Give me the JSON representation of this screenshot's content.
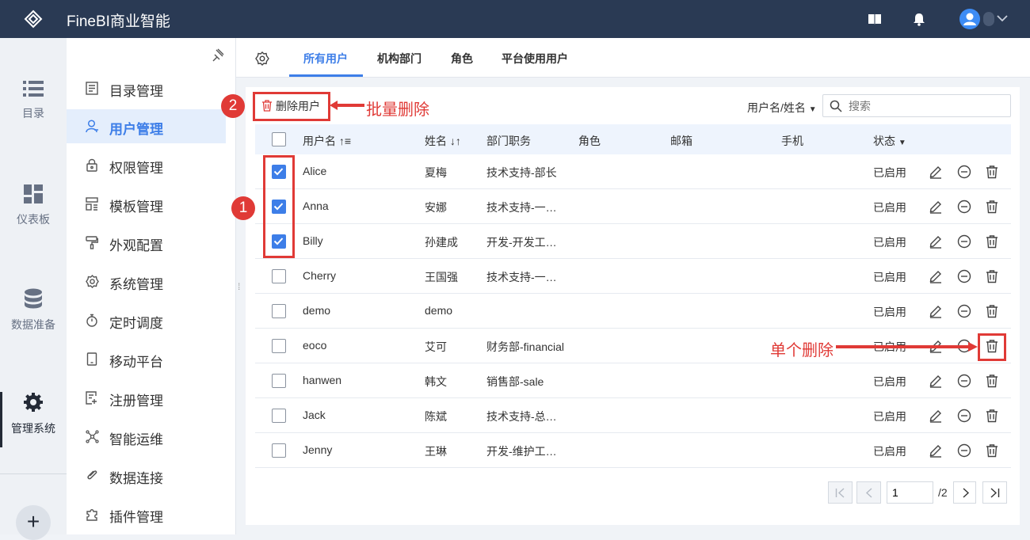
{
  "header": {
    "app_title": "FineBI商业智能"
  },
  "iconbar": {
    "items": [
      {
        "label": "目录",
        "icon": "list-icon"
      },
      {
        "label": "仪表板",
        "icon": "dashboard-icon"
      },
      {
        "label": "数据准备",
        "icon": "database-icon"
      },
      {
        "label": "管理系统",
        "icon": "gear-icon",
        "active": true
      }
    ],
    "add_label": "+"
  },
  "menu": {
    "items": [
      {
        "label": "目录管理",
        "icon": "catalog-icon"
      },
      {
        "label": "用户管理",
        "icon": "user-icon",
        "active": true
      },
      {
        "label": "权限管理",
        "icon": "lock-icon"
      },
      {
        "label": "模板管理",
        "icon": "template-icon"
      },
      {
        "label": "外观配置",
        "icon": "brush-icon"
      },
      {
        "label": "系统管理",
        "icon": "settings-icon"
      },
      {
        "label": "定时调度",
        "icon": "timer-icon"
      },
      {
        "label": "移动平台",
        "icon": "mobile-icon"
      },
      {
        "label": "注册管理",
        "icon": "register-icon"
      },
      {
        "label": "智能运维",
        "icon": "ops-icon"
      },
      {
        "label": "数据连接",
        "icon": "link-icon"
      },
      {
        "label": "插件管理",
        "icon": "plugin-icon"
      }
    ]
  },
  "tabs": [
    "所有用户",
    "机构部门",
    "角色",
    "平台使用用户"
  ],
  "toolbar": {
    "delete_label": "删除用户",
    "filter_label": "用户名/姓名",
    "search_placeholder": "搜索"
  },
  "annotations": {
    "badge1": "1",
    "badge2": "2",
    "batch_delete": "批量删除",
    "single_delete": "单个删除"
  },
  "table": {
    "columns": [
      "用户名",
      "姓名",
      "部门职务",
      "角色",
      "邮箱",
      "手机",
      "状态"
    ],
    "rows": [
      {
        "username": "Alice",
        "name": "夏梅",
        "dept": "技术支持-部长",
        "status": "已启用",
        "checked": true
      },
      {
        "username": "Anna",
        "name": "安娜",
        "dept": "技术支持-一…",
        "status": "已启用",
        "checked": true
      },
      {
        "username": "Billy",
        "name": "孙建成",
        "dept": "开发-开发工…",
        "status": "已启用",
        "checked": true
      },
      {
        "username": "Cherry",
        "name": "王国强",
        "dept": "技术支持-一…",
        "status": "已启用",
        "checked": false
      },
      {
        "username": "demo",
        "name": "demo",
        "dept": "",
        "status": "已启用",
        "checked": false
      },
      {
        "username": "eoco",
        "name": "艾可",
        "dept": "财务部-financial",
        "status": "已启用",
        "checked": false
      },
      {
        "username": "hanwen",
        "name": "韩文",
        "dept": "销售部-sale",
        "status": "已启用",
        "checked": false
      },
      {
        "username": "Jack",
        "name": "陈斌",
        "dept": "技术支持-总…",
        "status": "已启用",
        "checked": false
      },
      {
        "username": "Jenny",
        "name": "王琳",
        "dept": "开发-维护工…",
        "status": "已启用",
        "checked": false
      }
    ]
  },
  "pagination": {
    "current": "1",
    "total": "/2"
  },
  "colors": {
    "topbar": "#2a3a54",
    "accent": "#3d7ee8",
    "annotation": "#e03a36"
  }
}
